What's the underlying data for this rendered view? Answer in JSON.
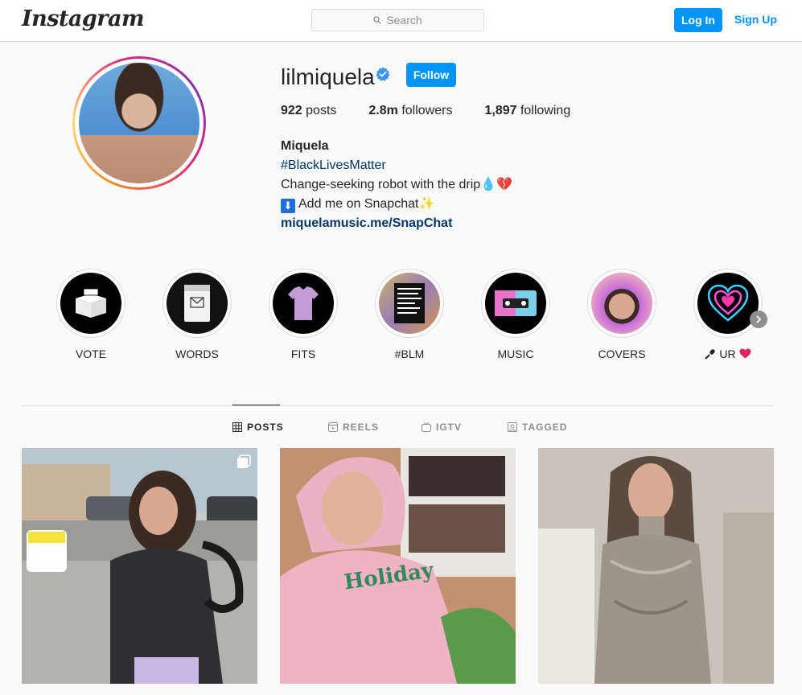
{
  "nav": {
    "logo": "Instagram",
    "search_placeholder": "Search",
    "login": "Log In",
    "signup": "Sign Up"
  },
  "profile": {
    "username": "lilmiquela",
    "follow": "Follow",
    "posts_count": "922",
    "posts_label": "posts",
    "followers_count": "2.8m",
    "followers_label": "followers",
    "following_count": "1,897",
    "following_label": "following",
    "name": "Miquela",
    "hashtag": "#BlackLivesMatter",
    "bio_line1": "Change-seeking robot with the drip",
    "bio_line1_emoji1": "💧",
    "bio_line1_emoji2": "💔",
    "bio_line2_arrow": "⬇",
    "bio_line2": "Add me on Snapchat",
    "bio_line2_emoji": "✨",
    "link": "miquelamusic.me/SnapChat"
  },
  "highlights": [
    {
      "label": "VOTE"
    },
    {
      "label": "WORDS"
    },
    {
      "label": "FITS"
    },
    {
      "label": "#BLM"
    },
    {
      "label": "MUSIC"
    },
    {
      "label": "COVERS"
    },
    {
      "label": "UR",
      "prefix_icon": "microphone",
      "suffix_icon": "heart"
    }
  ],
  "tabs": [
    {
      "label": "POSTS",
      "icon": "grid-icon",
      "active": true
    },
    {
      "label": "REELS",
      "icon": "reels-icon",
      "active": false
    },
    {
      "label": "IGTV",
      "icon": "igtv-icon",
      "active": false
    },
    {
      "label": "TAGGED",
      "icon": "tagged-icon",
      "active": false
    }
  ],
  "colors": {
    "accent": "#0095f6",
    "text": "#262626",
    "muted": "#8e8e8e",
    "border": "#dbdbdb",
    "link": "#00376b"
  }
}
